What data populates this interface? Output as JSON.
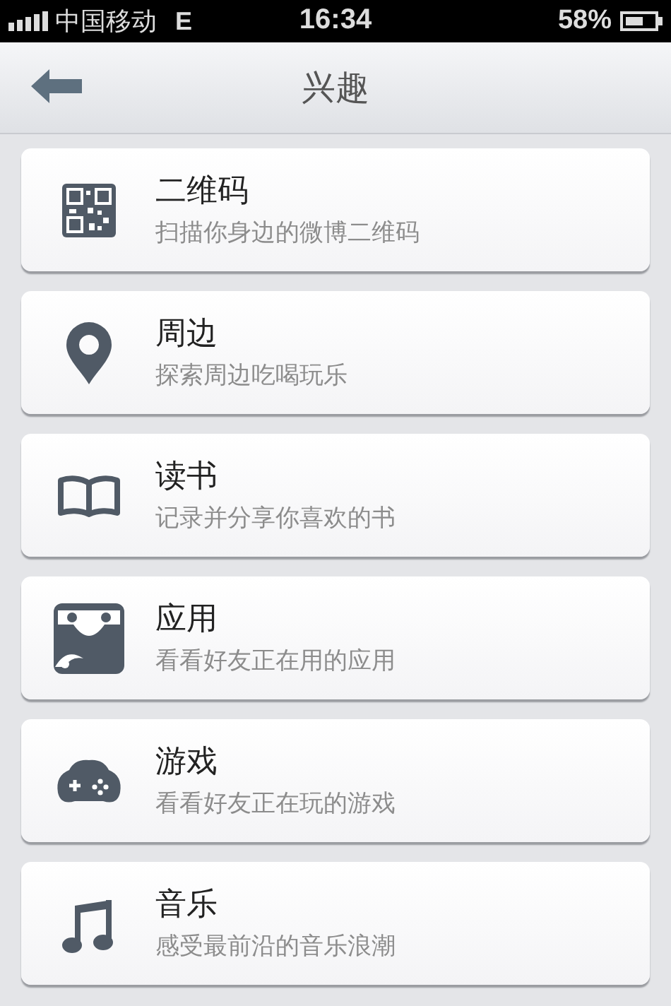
{
  "status_bar": {
    "carrier": "中国移动",
    "network": "E",
    "time": "16:34",
    "battery": "58%"
  },
  "nav_bar": {
    "title": "兴趣"
  },
  "items": [
    {
      "kind": "qr",
      "title": "二维码",
      "subtitle": "扫描你身边的微博二维码"
    },
    {
      "kind": "pin",
      "title": "周边",
      "subtitle": "探索周边吃喝玩乐"
    },
    {
      "kind": "book",
      "title": "读书",
      "subtitle": "记录并分享你喜欢的书"
    },
    {
      "kind": "app",
      "title": "应用",
      "subtitle": "看看好友正在用的应用"
    },
    {
      "kind": "game",
      "title": "游戏",
      "subtitle": "看看好友正在玩的游戏"
    },
    {
      "kind": "music",
      "title": "音乐",
      "subtitle": "感受最前沿的音乐浪潮"
    }
  ]
}
